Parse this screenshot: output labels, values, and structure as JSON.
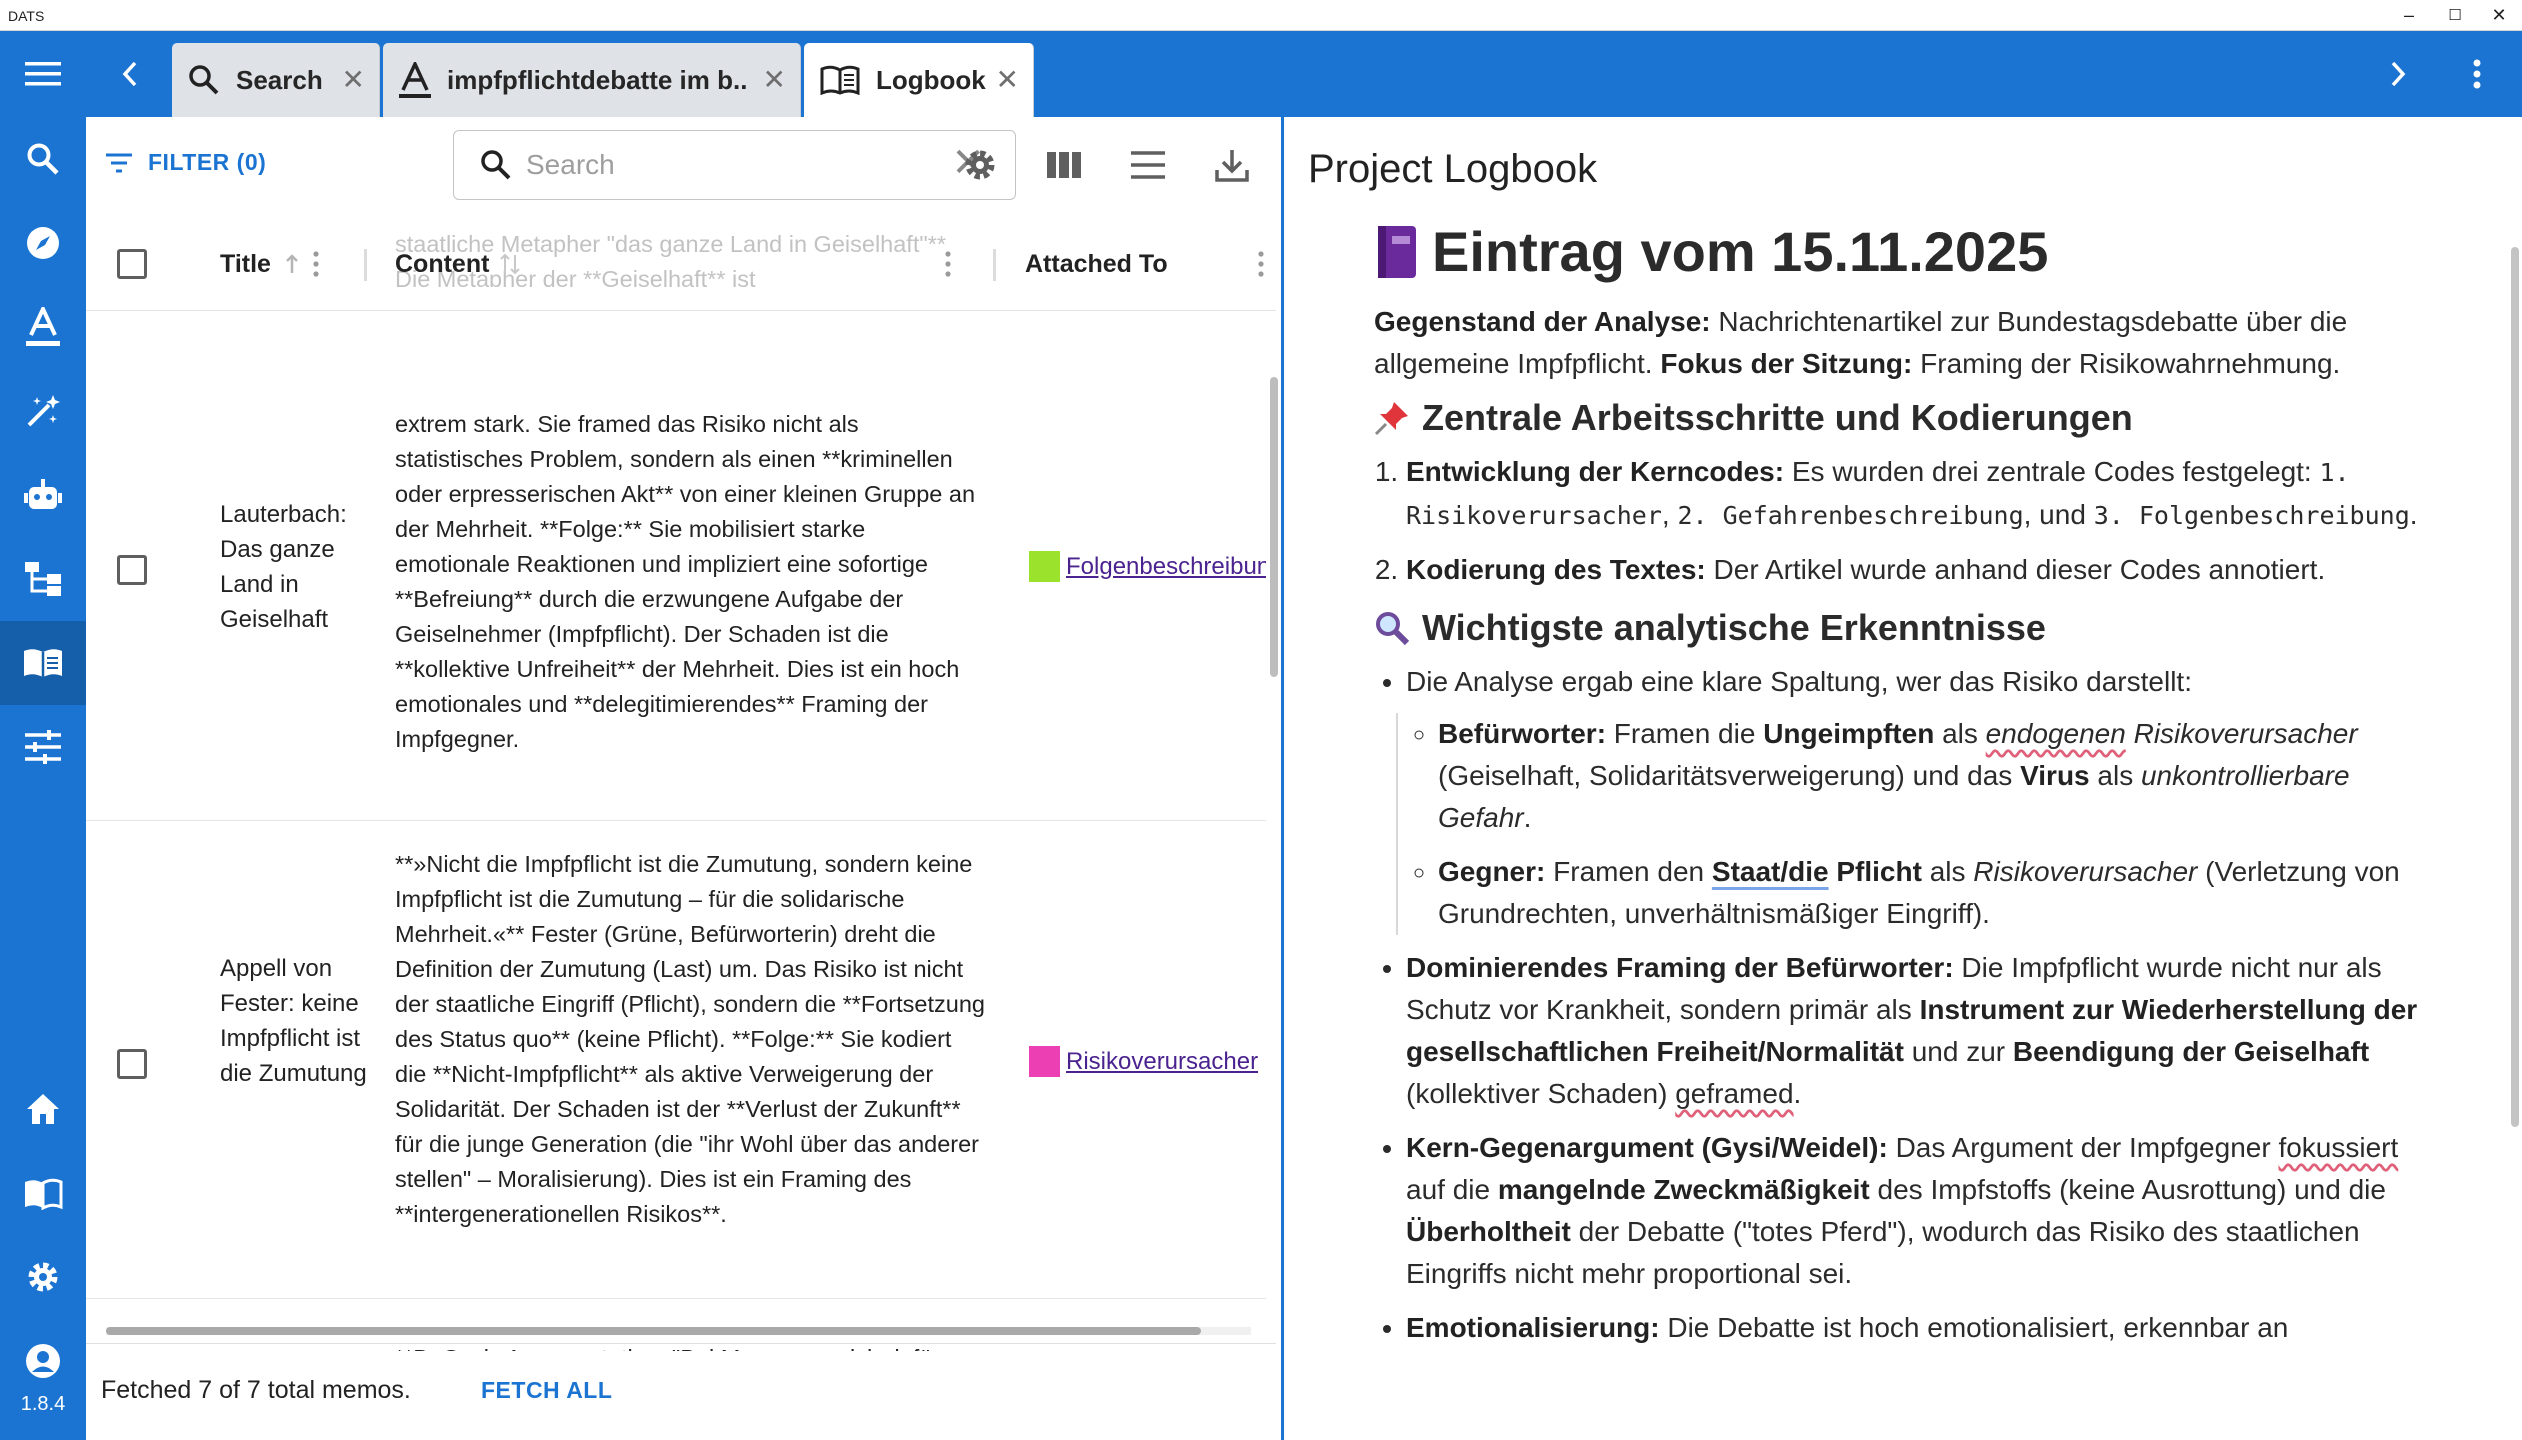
{
  "window": {
    "title": "DATS",
    "minimize": "–",
    "maximize": "☐",
    "close": "✕"
  },
  "appbar": {
    "tabs": [
      {
        "label": "Search",
        "icon": "search-icon",
        "close": "✕"
      },
      {
        "label": "impfpflichtdebatte im b...",
        "icon": "text-document-icon",
        "close": "✕"
      },
      {
        "label": "Logbook",
        "icon": "book-icon",
        "close": "✕",
        "active": true
      }
    ]
  },
  "sidebar": {
    "items": [
      "search-icon",
      "explore-icon",
      "annotation-icon",
      "auto-fix-icon",
      "robot-icon",
      "hierarchy-icon",
      "logbook-icon",
      "settings-sliders-icon",
      "home-icon",
      "docs-icon",
      "gear-icon",
      "account-icon"
    ],
    "version": "1.8.4"
  },
  "memos": {
    "filter_label": "FILTER (0)",
    "search_placeholder": "Search",
    "columns": {
      "title": "Title",
      "content": "Content",
      "attached": "Attached To"
    },
    "ghost_header_text": "staatliche Metapher \"das ganze Land in Geiselhaft\"** Die Metapher der **Geiselhaft** ist",
    "rows": [
      {
        "title": "Lauterbach: Das ganze Land in Geiselhaft",
        "content": "extrem stark. Sie framed das Risiko nicht als statistisches Problem, sondern als einen **kriminellen oder erpresserischen Akt** von einer kleinen Gruppe an der Mehrheit. **Folge:** Sie mobilisiert starke emotionale Reaktionen und impliziert eine sofortige **Befreiung** durch die erzwungene Aufgabe der Geiselnehmer (Impfpflicht). Der Schaden ist die **kollektive Unfreiheit** der Mehrheit. Dies ist ein hoch emotionales und **delegitimierendes** Framing der Impfgegner.",
        "attached": "Folgenbeschreibung",
        "attached_color": "#9be22d"
      },
      {
        "title": "Appell von Fester: keine Impfpflicht ist die Zumutung",
        "content": "**»Nicht die Impfpflicht ist die Zumutung, sondern keine Impfpflicht ist die Zumutung – für die solidarische Mehrheit.«** Fester (Grüne, Befürworterin) dreht die Definition der Zumutung (Last) um. Das Risiko ist nicht der staatliche Eingriff (Pflicht), sondern die **Fortsetzung des Status quo** (keine Pflicht). **Folge:** Sie kodiert die **Nicht-Impfpflicht** als aktive Verweigerung der Solidarität. Der Schaden ist der **Verlust der Zukunft** für die junge Generation (die \"ihr Wohl über das anderer stellen\" – Moralisierung). Dies ist ein Framing des **intergenerationellen Risikos**.",
        "attached": "Risikoverursacher",
        "attached_color": "#ec3fb3"
      },
      {
        "title": "",
        "content": "**B. Gysis Argumentation: \"Bei Masern war ich dafür, weil das die Krankheit ausrottete, das schafft der Impfstoff hier nicht\"** * **Interpretation:** Gysi",
        "attached": "",
        "attached_color": ""
      }
    ],
    "footer_text": "Fetched 7 of 7 total memos.",
    "fetch_all": "FETCH ALL"
  },
  "logbook": {
    "pane_title": "Project Logbook",
    "heading": "Eintrag vom 15.11.2025",
    "intro": {
      "label1": "Gegenstand der Analyse:",
      "text1": " Nachrichtenartikel zur Bundestagsdebatte über die allgemeine Impfpflicht. ",
      "label2": "Fokus der Sitzung:",
      "text2": " Framing der Risikowahrnehmung."
    },
    "section1": {
      "title": "Zentrale Arbeitsschritte und Kodierungen",
      "item1_label": "Entwicklung der Kerncodes:",
      "item1_text": " Es wurden drei zentrale Codes festgelegt: ",
      "code1": "1. Risikoverursacher",
      "sep1": ", ",
      "code2": "2. Gefahrenbeschreibung",
      "sep2": ", und ",
      "code3": "3. Folgenbeschreibung",
      "end": ".",
      "item2_label": "Kodierung des Textes:",
      "item2_text": " Der Artikel wurde anhand dieser Codes annotiert."
    },
    "section2": {
      "title": "Wichtigste analytische Erkenntnisse",
      "b1": "Die Analyse ergab eine klare Spaltung, wer das Risiko darstellt:",
      "pro_label": "Befürworter:",
      "pro_t1": " Framen die ",
      "pro_b1": "Ungeimpften",
      "pro_t2": " als ",
      "pro_i1": "endogenen",
      "pro_i2": " Risikoverursacher",
      "pro_t3": " (Geiselhaft, Solidaritätsverweigerung) und das ",
      "pro_b2": "Virus",
      "pro_t4": " als ",
      "pro_i3": "unkontrollierbare Gefahr",
      "pro_end": ".",
      "con_label": "Gegner:",
      "con_t1": " Framen den ",
      "con_b1": "Staat/die",
      "con_b2": " Pflicht",
      "con_t2": " als ",
      "con_i1": "Risikoverursacher",
      "con_t3": " (Verletzung von Grundrechten, unverhältnismäßiger Eingriff).",
      "b2_label": "Dominierendes Framing der Befürworter:",
      "b2_t1": " Die Impfpflicht wurde nicht nur als Schutz vor Krankheit, sondern primär als ",
      "b2_b1": "Instrument zur Wiederherstellung der gesellschaftlichen Freiheit/Normalität",
      "b2_t2": " und zur ",
      "b2_b2": "Beendigung der Geiselhaft",
      "b2_t3": " (kollektiver Schaden) ",
      "b2_sq": "geframed",
      "b2_end": ".",
      "b3_label": "Kern-Gegenargument (Gysi/Weidel):",
      "b3_t1": " Das Argument der Impfgegner ",
      "b3_sq": "fokussiert",
      "b3_t2": " auf die ",
      "b3_b1": "mangelnde Zweckmäßigkeit",
      "b3_t3": " des Impfstoffs (keine Ausrottung) und die ",
      "b3_b2": "Überholtheit",
      "b3_t4": " der Debatte (\"totes Pferd\"), wodurch das Risiko des staatlichen Eingriffs nicht mehr proportional sei.",
      "b4_label": "Emotionalisierung:",
      "b4_t1": " Die Debatte ist hoch emotionalisiert, erkennbar an"
    }
  },
  "colors": {
    "primary": "#1b74d2",
    "sidebar_active": "#155ea9",
    "link": "#4b2390"
  }
}
